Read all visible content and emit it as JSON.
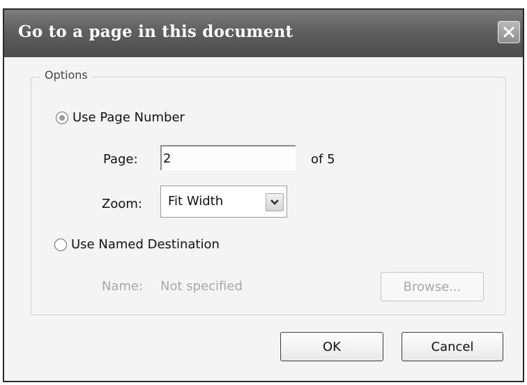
{
  "dialog": {
    "title": "Go to a page in this document"
  },
  "options": {
    "legend": "Options",
    "use_page_number_label": "Use Page Number",
    "use_page_number_checked": true,
    "page_label": "Page:",
    "page_value": "2",
    "page_total": "of 5",
    "zoom_label": "Zoom:",
    "zoom_value": "Fit Width",
    "use_named_destination_label": "Use Named Destination",
    "use_named_destination_checked": false,
    "name_label": "Name:",
    "name_value": "Not specified",
    "browse_label": "Browse..."
  },
  "buttons": {
    "ok_label": "OK",
    "cancel_label": "Cancel"
  },
  "icons": {
    "close": "close-icon",
    "dropdown": "chevron-down-icon"
  },
  "colors": {
    "titlebar": "#5f5f5f",
    "dialog_background": "#f4f4f4",
    "disabled_text": "#a8a8a8"
  }
}
